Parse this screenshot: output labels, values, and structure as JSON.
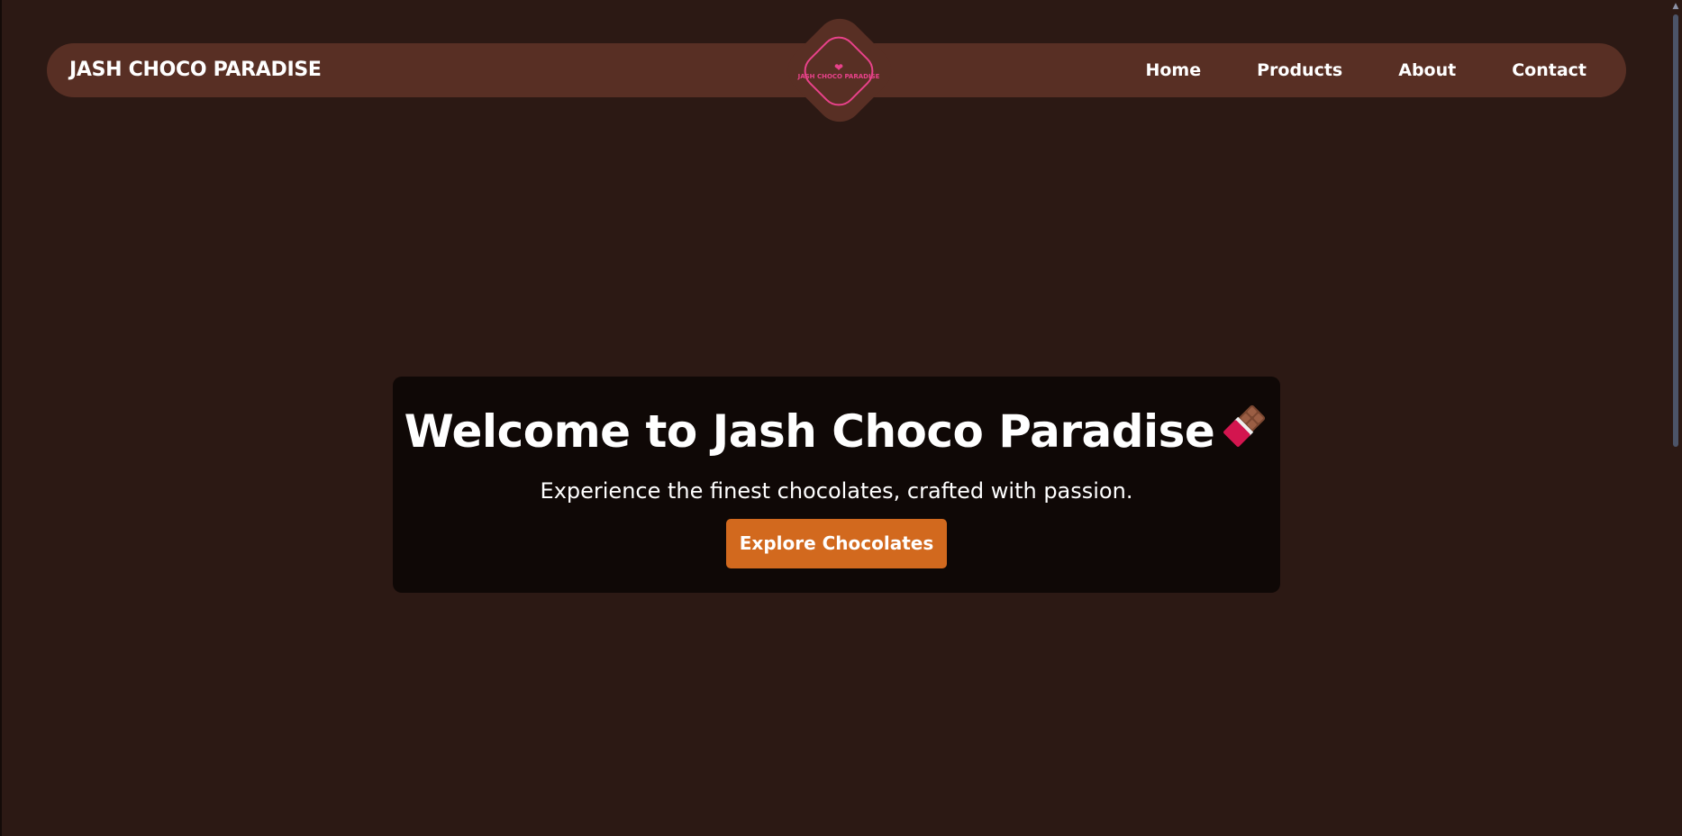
{
  "navbar": {
    "brand": "JASH CHOCO PARADISE",
    "logo_text": "JASH CHOCO PARADISE",
    "logo_icon": "heart-icon",
    "links": [
      "Home",
      "Products",
      "About",
      "Contact"
    ]
  },
  "hero": {
    "title": "Welcome to Jash Choco Paradise",
    "title_icon": "chocolate-bar-icon",
    "subtitle": "Experience the finest chocolates, crafted with passion.",
    "cta_label": "Explore Chocolates"
  },
  "colors": {
    "background": "#2c1914",
    "navbar": "#582f24",
    "hero_card": "#0f0806",
    "accent": "#d2691e",
    "logo_pink": "#e8428a",
    "text": "#ffffff"
  }
}
